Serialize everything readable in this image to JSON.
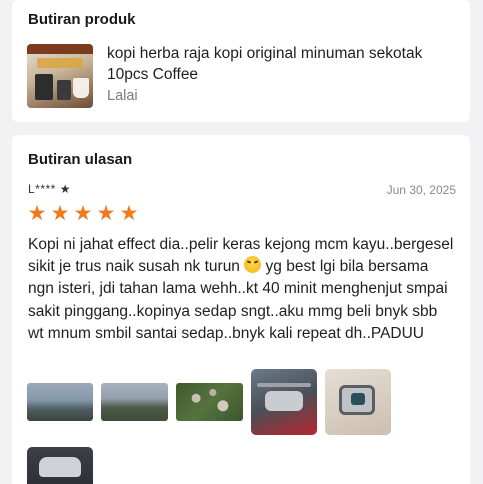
{
  "product_section": {
    "title": "Butiran produk",
    "product_name": "kopi herba raja kopi original minuman sekotak 10pcs Coffee",
    "variant": "Lalai",
    "thumbnail": "product-image"
  },
  "review_section": {
    "title": "Butiran ulasan",
    "reviewer": "L**** ★",
    "date": "Jun 30, 2025",
    "rating": 5,
    "star_color": "#f2781c",
    "text_part1": "Kopi ni jahat effect dia..pelir keras kejong mcm kayu..bergesel sikit je trus naik susah nk turun ",
    "emoji": "rolling-on-floor-laughing-emoji",
    "text_part2": " yg best lgi bila bersama ngn isteri, jdi tahan lama wehh..kt 40 minit menghenjut smpai sakit pinggang..kopinya sedap sngt..aku mmg beli bnyk sbb wt mnum smbil santai sedap..bnyk kali repeat dh..PADUU",
    "photos": [
      "aerial-photo",
      "aerial-photo",
      "aerial-photo",
      "drone-photo",
      "drone-camera-photo",
      "drone-photo"
    ]
  }
}
